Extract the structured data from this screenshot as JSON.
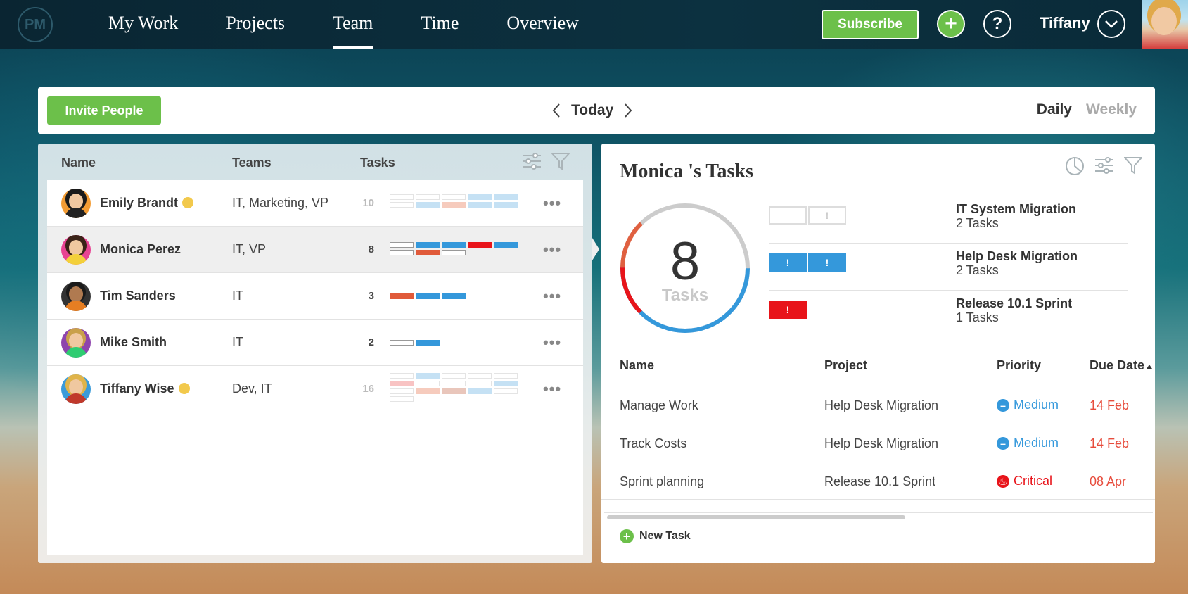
{
  "app": {
    "logo_text": "PM"
  },
  "nav": {
    "items": [
      {
        "label": "My Work"
      },
      {
        "label": "Projects"
      },
      {
        "label": "Team",
        "active": true
      },
      {
        "label": "Time"
      },
      {
        "label": "Overview"
      }
    ],
    "subscribe_label": "Subscribe",
    "plus_symbol": "+",
    "help_symbol": "?",
    "user_name": "Tiffany"
  },
  "toolbar": {
    "invite_label": "Invite People",
    "date_label": "Today",
    "daily_label": "Daily",
    "weekly_label": "Weekly"
  },
  "people_table": {
    "headers": {
      "name": "Name",
      "teams": "Teams",
      "tasks": "Tasks"
    },
    "more_symbol": "•••",
    "rows": [
      {
        "name": "Emily Brandt",
        "online": true,
        "teams": "IT, Marketing, VP",
        "tasks": "10",
        "faded": true,
        "shirt_color": "#222222",
        "avatar_bg": "#f39c34"
      },
      {
        "name": "Monica Perez",
        "online": false,
        "teams": "IT, VP",
        "tasks": "8",
        "faded": false,
        "selected": true,
        "shirt_color": "#f3d03a",
        "avatar_bg": "#e84393"
      },
      {
        "name": "Tim Sanders",
        "online": false,
        "teams": "IT",
        "tasks": "3",
        "faded": false,
        "shirt_color": "#e67e22",
        "avatar_bg": "#333333"
      },
      {
        "name": "Mike Smith",
        "online": false,
        "teams": "IT",
        "tasks": "2",
        "faded": false,
        "shirt_color": "#2ecc71",
        "avatar_bg": "#8e44ad"
      },
      {
        "name": "Tiffany Wise",
        "online": true,
        "teams": "Dev, IT",
        "tasks": "16",
        "faded": true,
        "shirt_color": "#c0392b",
        "avatar_bg": "#3a9bd9"
      }
    ]
  },
  "tasks_panel": {
    "title": "Monica 's Tasks",
    "total": "8",
    "total_label": "Tasks",
    "ring_colors": {
      "gray": "#cccccc",
      "blue": "#3498db",
      "red": "#e8141a",
      "orange": "#e06040"
    },
    "projects": [
      {
        "name": "IT System Migration",
        "count": "2 Tasks"
      },
      {
        "name": "Help Desk Migration",
        "count": "2 Tasks"
      },
      {
        "name": "Release 10.1 Sprint",
        "count": "1 Tasks"
      }
    ],
    "chip_mark": "!",
    "table": {
      "headers": {
        "name": "Name",
        "project": "Project",
        "priority": "Priority",
        "due": "Due Date"
      },
      "rows": [
        {
          "name": "Manage Work",
          "project": "Help Desk Migration",
          "priority": "Medium",
          "priority_symbol": "–",
          "due": "14 Feb"
        },
        {
          "name": "Track Costs",
          "project": "Help Desk Migration",
          "priority": "Medium",
          "priority_symbol": "–",
          "due": "14 Feb"
        },
        {
          "name": "Sprint planning",
          "project": "Release 10.1 Sprint",
          "priority": "Critical",
          "priority_symbol": "♨",
          "due": "08 Apr"
        }
      ]
    },
    "new_task_label": "New Task",
    "new_task_symbol": "+"
  },
  "colors": {
    "accent_green": "#6cc04a",
    "task_blue": "#3498db",
    "task_red": "#e8141a",
    "task_orange": "#e05a3a",
    "due_red": "#e74c3c"
  }
}
